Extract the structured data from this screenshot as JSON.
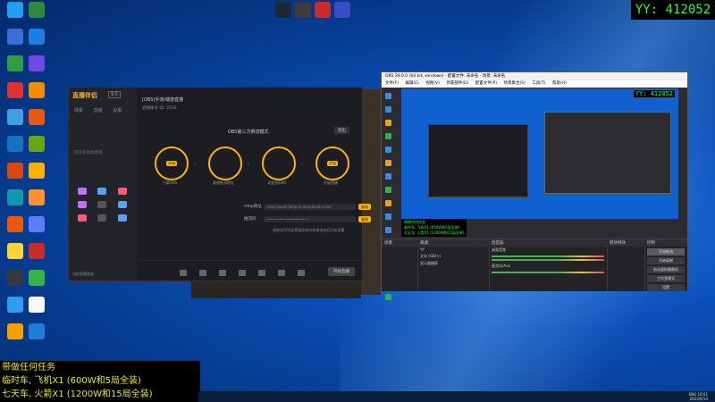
{
  "overlay_counter": "YY: 412052",
  "desktop": {
    "icons": [
      {
        "label": "",
        "color": "#1da1f2"
      },
      {
        "label": "",
        "color": "#2b8a3e"
      },
      {
        "label": "",
        "color": "#3a6fd8"
      },
      {
        "label": "",
        "color": "#1a7fe0"
      },
      {
        "label": "",
        "color": "#2f9e44"
      },
      {
        "label": "",
        "color": "#7048e8"
      },
      {
        "label": "",
        "color": "#e03131"
      },
      {
        "label": "",
        "color": "#f08c00"
      },
      {
        "label": "",
        "color": "#3ba1e0"
      },
      {
        "label": "",
        "color": "#e8590c"
      },
      {
        "label": "",
        "color": "#1971c2"
      },
      {
        "label": "",
        "color": "#66a80f"
      },
      {
        "label": "",
        "color": "#d9480f"
      },
      {
        "label": "",
        "color": "#fab005"
      },
      {
        "label": "",
        "color": "#1098ad"
      },
      {
        "label": "",
        "color": "#ff922b"
      },
      {
        "label": "",
        "color": "#e8590c"
      },
      {
        "label": "",
        "color": "#5c7cfa"
      },
      {
        "label": "",
        "color": "#ffd43b"
      },
      {
        "label": "",
        "color": "#c92a2a"
      },
      {
        "label": "",
        "color": "#343a40"
      },
      {
        "label": "",
        "color": "#37b24d"
      },
      {
        "label": "",
        "color": "#339af0"
      },
      {
        "label": "",
        "color": "#f8f9fa"
      },
      {
        "label": "",
        "color": "#f59f00"
      },
      {
        "label": "",
        "color": "#1c7ed6"
      }
    ],
    "top_icons": [
      {
        "label": "",
        "color": "#1b2838"
      },
      {
        "label": "",
        "color": "#3c3c3c"
      },
      {
        "label": "",
        "color": "#c92a2a"
      },
      {
        "label": "",
        "color": "#364fc7"
      }
    ]
  },
  "zhiboban": {
    "app_name": "直播伴侣",
    "version": "9.5",
    "tabs": [
      "场景",
      "直播",
      "设置"
    ],
    "empty_text": "还没有添加场景",
    "tools": [
      "",
      "",
      " ",
      "",
      "",
      "",
      "",
      "",
      ""
    ],
    "footer_text": "当前直播状态",
    "room_title": "[OBS]手游/端游直播",
    "room_sub": "直播帐号 ID: 2618",
    "mode_label": "OBS第三方推流模式",
    "exit_btn": "退出",
    "steps": [
      {
        "pill": "开始",
        "caption": "下载OBS"
      },
      {
        "pill": "",
        "caption": "复制推流地址"
      },
      {
        "pill": "",
        "caption": "粘贴到OBS"
      },
      {
        "pill": "开始",
        "caption": "开始直播"
      }
    ],
    "rtmp_label": "rtmp地址",
    "rtmp_value": "rtmp://push-rtmp-l1.douyincdn.com/",
    "key_label": "推流码",
    "key_value": "••••••••••••••••••••",
    "copy_label": "复制",
    "hint": "请使用OBS配置推流地址和推流码后开始直播",
    "bottom_tools": [
      "",
      "",
      "",
      "",
      "",
      "",
      ""
    ],
    "start_btn": "开始直播"
  },
  "obs": {
    "title": "OBS 29.0.0 (64 bit, windows) - 配置文件: 未命名 - 场景: 未命名",
    "menu": [
      "文件(F)",
      "编辑(E)",
      "视图(V)",
      "停靠部件(D)",
      "配置文件(P)",
      "场景集合(S)",
      "工具(T)",
      "帮助(H)"
    ],
    "preview_counter": "YY: 412052",
    "note_lines": [
      "带做任何任务",
      "临时车, 飞机X1 (600W和5局全装)",
      "七天车, 火箭X1 (1200W和15局全装)"
    ],
    "status": "无源已选择",
    "docks": {
      "scenes_header": "场景",
      "sources_header": "来源",
      "sources": [
        "YY",
        "文本 (GDI+)",
        "显示器捕获"
      ],
      "mixer_header": "混音器",
      "mixer_rows": [
        "桌面音频",
        "麦克风/Aux"
      ],
      "transitions_header": "转场特效",
      "controls_header": "控制",
      "controls": [
        "开始推流",
        "开始录制",
        "启动虚拟摄像机",
        "工作室模式",
        "设置",
        "退出"
      ]
    }
  },
  "text_overlay": {
    "lines": [
      "带做任何任务",
      "临时车, 飞机X1 (600W和5局全装)",
      "七天车, 火箭X1 (1200W和15局全装)"
    ]
  },
  "taskbar": {
    "clock_time": "16:01",
    "clock_date": "2023/9/14",
    "lang": "ENG"
  }
}
